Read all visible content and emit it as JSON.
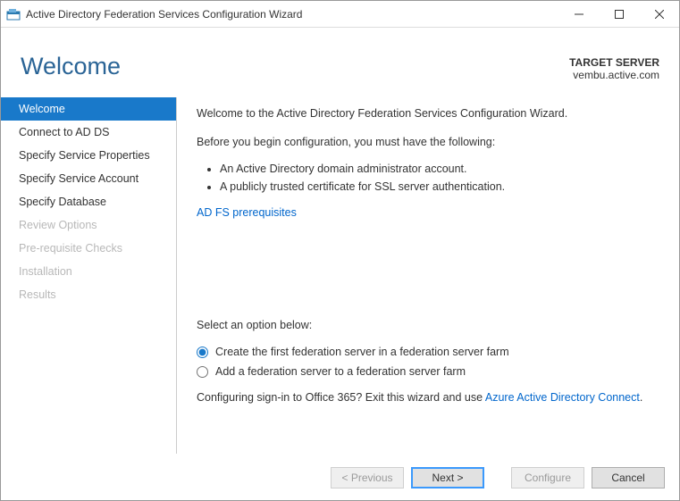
{
  "window": {
    "title": "Active Directory Federation Services Configuration Wizard"
  },
  "header": {
    "heading": "Welcome",
    "target_label": "TARGET SERVER",
    "target_value": "vembu.active.com"
  },
  "sidebar": {
    "steps": [
      {
        "label": "Welcome",
        "state": "active"
      },
      {
        "label": "Connect to AD DS",
        "state": "enabled"
      },
      {
        "label": "Specify Service Properties",
        "state": "enabled"
      },
      {
        "label": "Specify Service Account",
        "state": "enabled"
      },
      {
        "label": "Specify Database",
        "state": "enabled"
      },
      {
        "label": "Review Options",
        "state": "disabled"
      },
      {
        "label": "Pre-requisite Checks",
        "state": "disabled"
      },
      {
        "label": "Installation",
        "state": "disabled"
      },
      {
        "label": "Results",
        "state": "disabled"
      }
    ]
  },
  "content": {
    "intro": "Welcome to the Active Directory Federation Services Configuration Wizard.",
    "before": "Before you begin configuration, you must have the following:",
    "bullets": [
      "An Active Directory domain administrator account.",
      "A publicly trusted certificate for SSL server authentication."
    ],
    "prereq_link": "AD FS prerequisites",
    "select_label": "Select an option below:",
    "options": [
      "Create the first federation server in a federation server farm",
      "Add a federation server to a federation server farm"
    ],
    "o365_prefix": "Configuring sign-in to Office 365? Exit this wizard and use ",
    "o365_link": "Azure Active Directory Connect",
    "o365_suffix": "."
  },
  "footer": {
    "previous": "< Previous",
    "next": "Next >",
    "configure": "Configure",
    "cancel": "Cancel"
  }
}
